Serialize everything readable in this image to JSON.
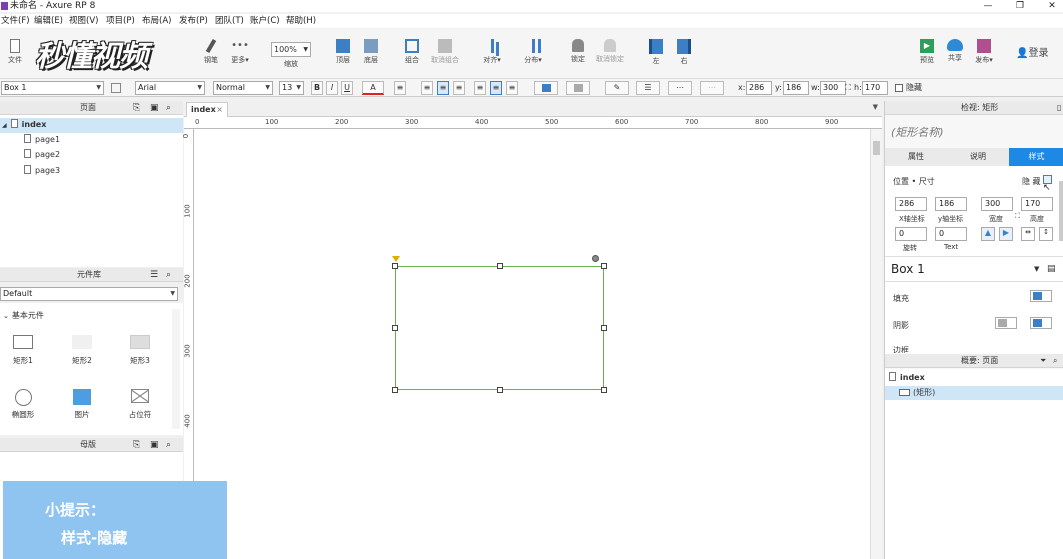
{
  "window": {
    "title": "未命名 - Axure RP 8",
    "minimize": "—",
    "restore": "❐",
    "close": "✕"
  },
  "menu": [
    "文件(F)",
    "编辑(E)",
    "视图(V)",
    "项目(P)",
    "布局(A)",
    "发布(P)",
    "团队(T)",
    "账户(C)",
    "帮助(H)"
  ],
  "logo_text": "秒懂视频",
  "toolbar": {
    "file": "文件",
    "pen": "钢笔",
    "more": "更多▾",
    "zoom_value": "100%",
    "zoom_label": "缩放",
    "top": "顶层",
    "bottom": "底层",
    "group": "组合",
    "ungroup": "取消组合",
    "align": "对齐▾",
    "distribute": "分布▾",
    "lock": "锁定",
    "unlock": "取消锁定",
    "left": "左",
    "right": "右",
    "preview": "预览",
    "share": "共享",
    "publish": "发布▾",
    "login": "登录"
  },
  "format": {
    "widget_name": "Box 1",
    "font": "Arial",
    "style": "Normal",
    "size": "13",
    "x_label": "x:",
    "x": "286",
    "y_label": "y:",
    "y": "186",
    "w_label": "w:",
    "w": "300",
    "h_label": "h:",
    "h": "170",
    "hide": "隐藏"
  },
  "pages_panel": {
    "title": "页面",
    "root": "index",
    "pages": [
      "page1",
      "page2",
      "page3"
    ]
  },
  "library_panel": {
    "title": "元件库",
    "library": "Default",
    "section": "基本元件",
    "widgets": [
      "矩形1",
      "矩形2",
      "矩形3",
      "椭圆形",
      "图片",
      "占位符"
    ]
  },
  "masters_panel": {
    "title": "母版"
  },
  "canvas": {
    "tab": "index",
    "ruler_h": [
      "0",
      "100",
      "200",
      "300",
      "400",
      "500",
      "600",
      "700",
      "800",
      "900"
    ],
    "ruler_v": [
      "0",
      "100",
      "200",
      "300",
      "400"
    ]
  },
  "inspector": {
    "title": "检视: 矩形",
    "shape_name_placeholder": "(矩形名称)",
    "tabs": [
      "属性",
      "说明",
      "样式"
    ],
    "section": "位置 • 尺寸",
    "hide": "隐 藏",
    "x": "286",
    "y": "186",
    "w": "300",
    "h": "170",
    "x_lbl": "X轴坐标",
    "y_lbl": "y轴坐标",
    "w_lbl": "宽度",
    "h_lbl": "高度",
    "rot": "0",
    "text_rot": "0",
    "rot_lbl": "旋转",
    "text_lbl": "Text",
    "style_name": "Box 1",
    "fill": "填充",
    "shadow": "阴影",
    "border": "边框"
  },
  "outline": {
    "title": "概要: 页面",
    "root": "index",
    "item": "(矩形)"
  },
  "tip": {
    "line1": "小提示：",
    "line2": "样式-隐藏"
  },
  "colors": {
    "accent": "#3d7fc4",
    "selection": "#6ab04c",
    "tip_bg": "#8fc3f0",
    "active_tab": "#1e88e5"
  }
}
